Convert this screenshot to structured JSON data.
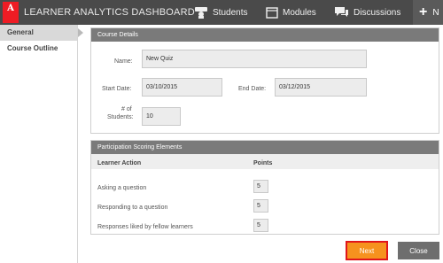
{
  "app": {
    "logo_text": "A",
    "logo_subtext": "Adobe",
    "title": "LEARNER ANALYTICS DASHBOARD",
    "brand_color": "#ee1c24"
  },
  "nav": {
    "students": {
      "label": "Students",
      "icon": "students-icon"
    },
    "modules": {
      "label": "Modules",
      "icon": "modules-icon"
    },
    "discussions": {
      "label": "Discussions",
      "icon": "discussions-icon"
    },
    "add": {
      "label": "+",
      "trailing": "N"
    }
  },
  "sidebar": {
    "items": [
      {
        "label": "General",
        "active": true
      },
      {
        "label": "Course Outline",
        "active": false
      }
    ]
  },
  "course_details": {
    "header": "Course Details",
    "name_label": "Name:",
    "name_value": "New Quiz",
    "start_label": "Start Date:",
    "start_value": "03/10/2015",
    "end_label": "End Date:",
    "end_value": "03/12/2015",
    "students_label_1": "# of",
    "students_label_2": "Students:",
    "students_value": "10"
  },
  "scoring": {
    "header": "Participation Scoring Elements",
    "col_action": "Learner Action",
    "col_points": "Points",
    "rows": [
      {
        "label": "Asking a question",
        "points": "5"
      },
      {
        "label": "Responding to a question",
        "points": "5"
      },
      {
        "label": "Responses liked by fellow learners",
        "points": "5"
      }
    ]
  },
  "actions": {
    "next_label": "Next",
    "close_label": "Close",
    "next_color": "#f6921e"
  }
}
